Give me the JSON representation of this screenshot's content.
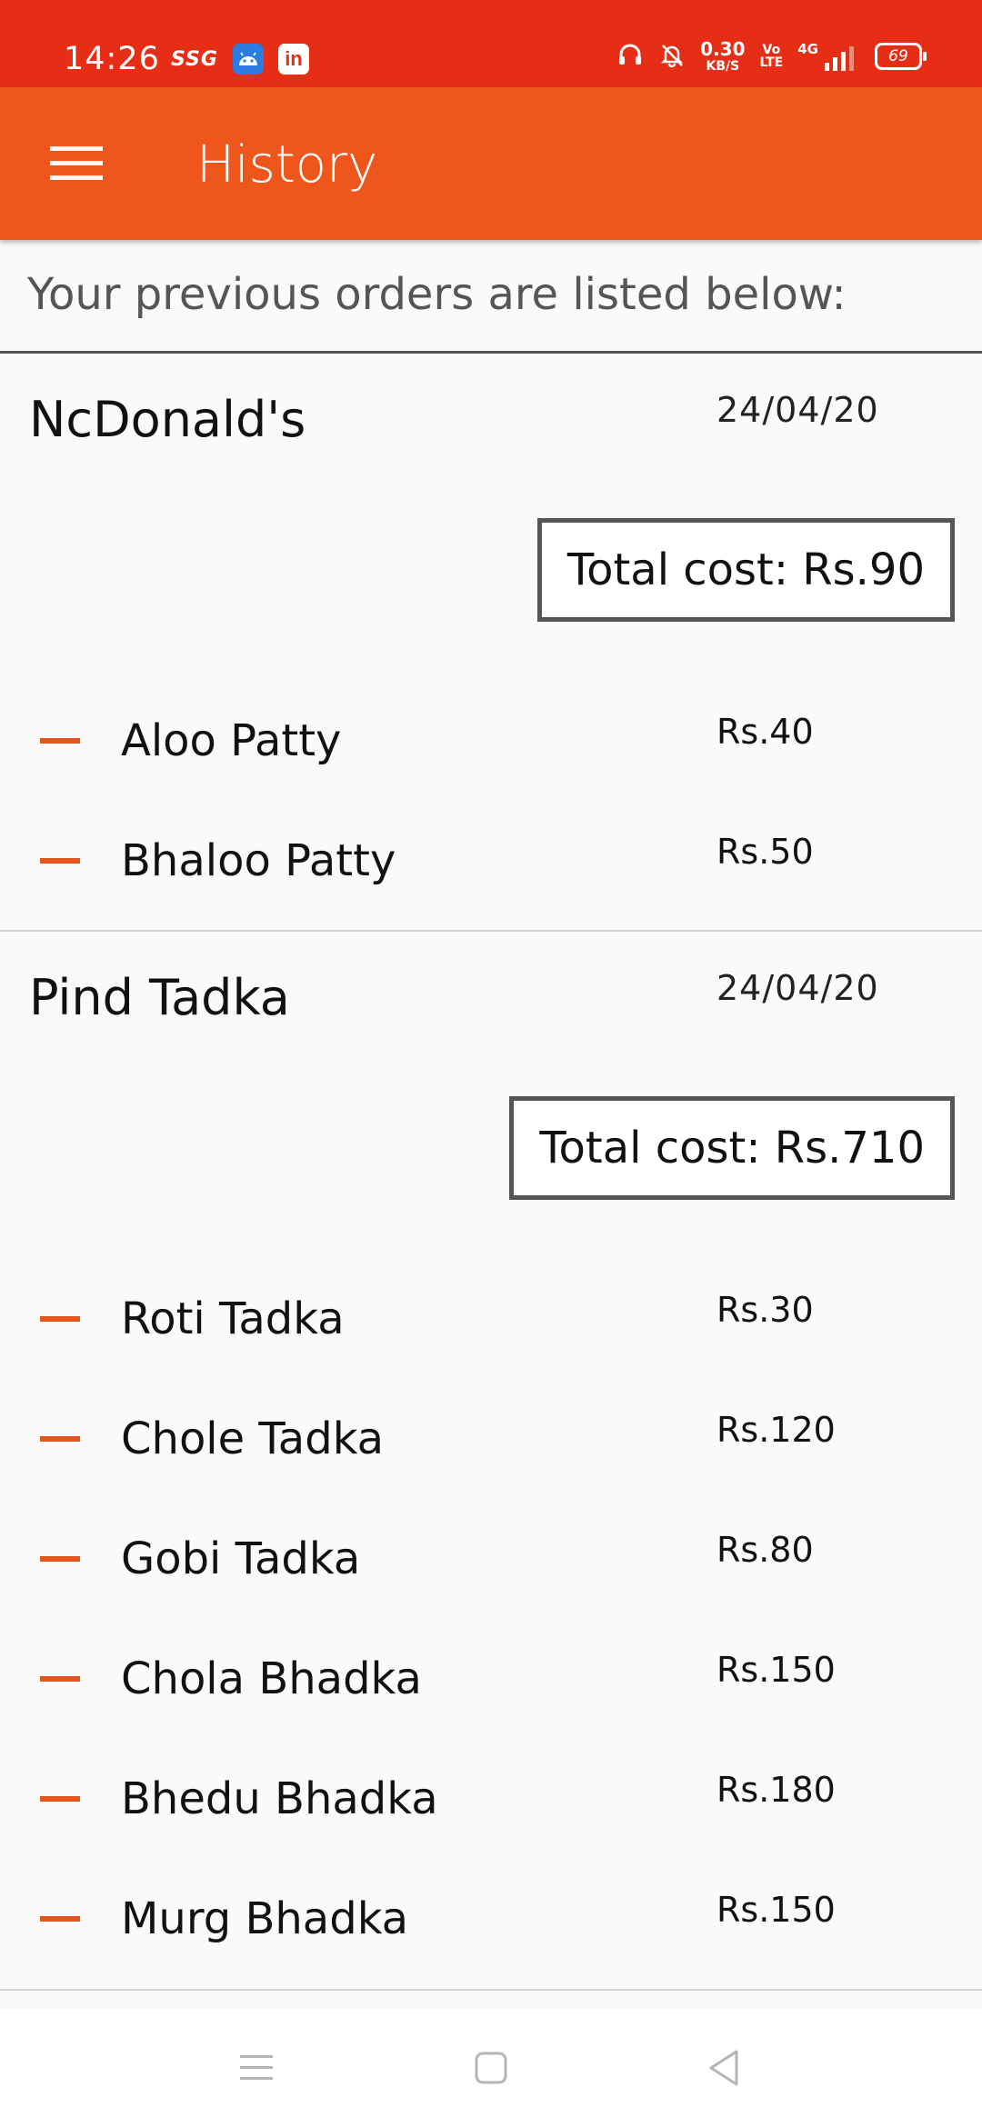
{
  "status_bar": {
    "time": "14:26",
    "carrier_tag": "SSG",
    "linkedin_glyph": "in",
    "net_speed_value": "0.30",
    "net_speed_unit": "KB/S",
    "volte_top": "Vo",
    "volte_bottom": "LTE",
    "network_type": "4G",
    "battery_level": "69",
    "left_icons": [
      "ssg-icon",
      "android-icon",
      "linkedin-icon"
    ],
    "right_icons": [
      "headphones-icon",
      "bell-off-icon",
      "net-speed",
      "volte-icon",
      "signal-icon",
      "battery-icon"
    ]
  },
  "app_bar": {
    "title": "History",
    "menu_icon": "hamburger-menu-icon",
    "background_color": "#ef561c"
  },
  "intro_text": "Your previous orders are listed below:",
  "colors": {
    "status_bar": "#e62e16",
    "accent": "#e3561e"
  },
  "orders": [
    {
      "restaurant": "NcDonald's",
      "date": "24/04/20",
      "total": "Total cost: Rs.90",
      "items": [
        {
          "name": "Aloo Patty",
          "price": "Rs.40"
        },
        {
          "name": "Bhaloo Patty",
          "price": "Rs.50"
        }
      ]
    },
    {
      "restaurant": "Pind Tadka",
      "date": "24/04/20",
      "total": "Total cost: Rs.710",
      "items": [
        {
          "name": "Roti Tadka",
          "price": "Rs.30"
        },
        {
          "name": "Chole Tadka",
          "price": "Rs.120"
        },
        {
          "name": "Gobi Tadka",
          "price": "Rs.80"
        },
        {
          "name": "Chola Bhadka",
          "price": "Rs.150"
        },
        {
          "name": "Bhedu Bhadka",
          "price": "Rs.180"
        },
        {
          "name": "Murg Bhadka",
          "price": "Rs.150"
        }
      ]
    }
  ],
  "nav_bar": {
    "buttons": [
      "recents-icon",
      "home-icon",
      "back-icon"
    ]
  }
}
